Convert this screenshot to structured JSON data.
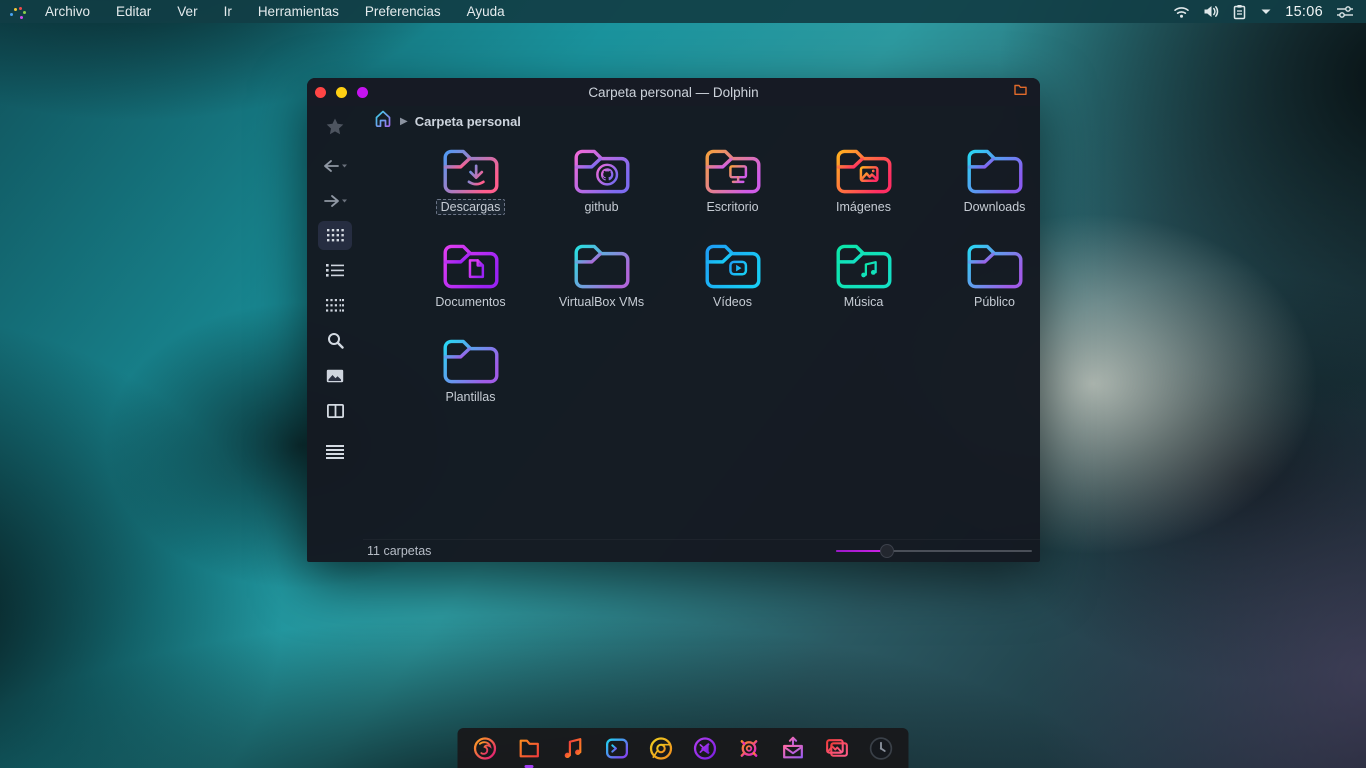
{
  "topbar": {
    "menus": [
      "Archivo",
      "Editar",
      "Ver",
      "Ir",
      "Herramientas",
      "Preferencias",
      "Ayuda"
    ],
    "clock": "15:06",
    "tray_icons": [
      "wifi",
      "volume",
      "clipboard",
      "caret-down",
      "tweaks"
    ]
  },
  "window": {
    "title": "Carpeta personal — Dolphin",
    "traffic_lights": {
      "close": "#ff4545",
      "minimize": "#ffd013",
      "maximize": "#c513f0"
    },
    "breadcrumb": {
      "current": "Carpeta personal"
    },
    "sidebar_tools": [
      "favorites",
      "back",
      "forward",
      "icons-view",
      "details-view",
      "compact-view",
      "search",
      "preview",
      "split",
      "menu"
    ],
    "folders": [
      {
        "label": "Descargas",
        "glyph": "download",
        "c1": "#4e9af5",
        "c2": "#ff5e8e",
        "selected": true
      },
      {
        "label": "github",
        "glyph": "github",
        "c1": "#f06ad8",
        "c2": "#7d6bf0"
      },
      {
        "label": "Escritorio",
        "glyph": "monitor",
        "c1": "#f5a03c",
        "c2": "#d05ce8"
      },
      {
        "label": "Imágenes",
        "glyph": "image",
        "c1": "#ffb01f",
        "c2": "#ff2e63"
      },
      {
        "label": "Downloads",
        "glyph": "none",
        "c1": "#27d7f2",
        "c2": "#8a5cf0"
      },
      {
        "label": "Documentos",
        "glyph": "document",
        "c1": "#e03df0",
        "c2": "#9a22f5"
      },
      {
        "label": "VirtualBox VMs",
        "glyph": "none",
        "c1": "#27e0e0",
        "c2": "#b066d9"
      },
      {
        "label": "Vídeos",
        "glyph": "video",
        "c1": "#1e9df5",
        "c2": "#18ccf5"
      },
      {
        "label": "Música",
        "glyph": "music",
        "c1": "#0ce6a8",
        "c2": "#14e0c4"
      },
      {
        "label": "Público",
        "glyph": "none",
        "c1": "#27d7f2",
        "c2": "#a05ce8"
      },
      {
        "label": "Plantillas",
        "glyph": "none",
        "c1": "#27d7f2",
        "c2": "#a05ce8"
      }
    ],
    "status": {
      "items_text": "11 carpetas",
      "slider_accent": "#c81ee0"
    }
  },
  "dock": {
    "items": [
      {
        "name": "firefox",
        "c1": "#ffa41f",
        "c2": "#e0157a"
      },
      {
        "name": "file-manager",
        "c1": "#ff8c1f",
        "c2": "#f03c3c"
      },
      {
        "name": "music-player",
        "c1": "#f03c3c",
        "c2": "#ff8c1f"
      },
      {
        "name": "terminal",
        "c1": "#1fd4f0",
        "c2": "#8a3cf0"
      },
      {
        "name": "chromium",
        "c1": "#f0d01f",
        "c2": "#f08c1f"
      },
      {
        "name": "vscode",
        "c1": "#b03df0",
        "c2": "#7a1fe0"
      },
      {
        "name": "settings",
        "c1": "#ff8c1f",
        "c2": "#e01fd0"
      },
      {
        "name": "mail",
        "c1": "#ff6ba8",
        "c2": "#9a5cf0"
      },
      {
        "name": "photos",
        "c1": "#f03c3c",
        "c2": "#ff5c8a"
      },
      {
        "name": "clock-widget",
        "c1": "#3a4048",
        "c2": "#8a919c"
      }
    ]
  }
}
